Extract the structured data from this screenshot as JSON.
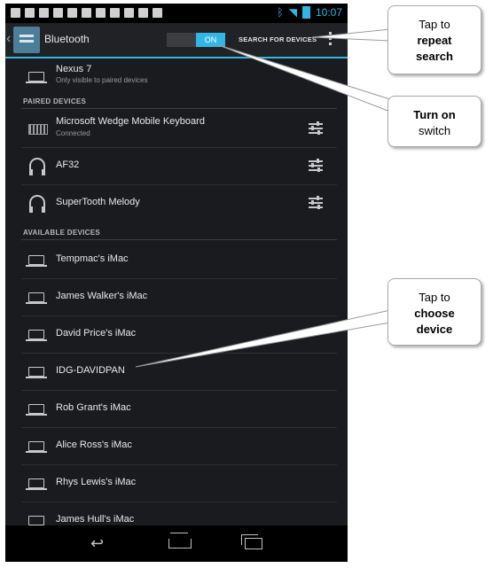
{
  "status_bar": {
    "time": "10:07"
  },
  "action_bar": {
    "title": "Bluetooth",
    "toggle_state": "ON",
    "search_label": "SEARCH FOR DEVICES"
  },
  "this_device": {
    "name": "Nexus 7",
    "status": "Only visible to paired devices"
  },
  "paired_section": {
    "header": "PAIRED DEVICES",
    "items": [
      {
        "name": "Microsoft Wedge Mobile Keyboard",
        "status": "Connected",
        "icon": "keyboard-icon"
      },
      {
        "name": "AF32",
        "status": "",
        "icon": "headset-icon"
      },
      {
        "name": "SuperTooth Melody",
        "status": "",
        "icon": "headset-icon"
      }
    ]
  },
  "available_section": {
    "header": "AVAILABLE DEVICES",
    "items": [
      "Tempmac's iMac",
      "James Walker's iMac",
      "David Price's iMac",
      "IDG-DAVIDPAN",
      "Rob Grant's iMac",
      "Alice Ross's iMac",
      "Rhys Lewis's iMac",
      "James Hull's iMac"
    ]
  },
  "callouts": {
    "repeat_search": {
      "line1": "Tap to",
      "line2": "repeat",
      "line3": "search"
    },
    "turn_on": {
      "line1": "Turn on",
      "line2": "switch"
    },
    "choose_device": {
      "line1": "Tap to",
      "line2": "choose",
      "line3": "device"
    }
  },
  "colors": {
    "accent": "#33b5e5",
    "background": "#191b1e",
    "callout_bg": "#ffffff"
  }
}
